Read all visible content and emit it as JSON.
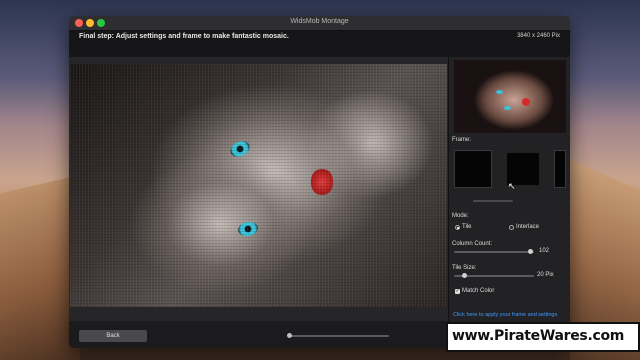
{
  "window": {
    "title": "WidsMob Montage"
  },
  "topbar": {
    "instruction": "Final step: Adjust settings and frame to make fantastic mosaic.",
    "dimensions": "3840 x 2460 Pix"
  },
  "sidebar": {
    "frame_label": "Frame:",
    "mode_label": "Mode:",
    "mode_options": [
      "Tile",
      "Interlace"
    ],
    "mode_selected": "Tile",
    "column_count_label": "Column Count:",
    "column_count_value": "102",
    "tile_size_label": "Tile Size:",
    "tile_size_value": "20 Pix",
    "match_color_label": "Match Color",
    "match_color_checked": true,
    "apply_link": "Click here to apply your frame and settings"
  },
  "bottombar": {
    "back_label": "Back"
  },
  "watermark": "www.PirateWares.com",
  "colors": {
    "accent": "#2e6fd9",
    "link": "#3f9bff",
    "window_bg": "#1e1e20"
  }
}
